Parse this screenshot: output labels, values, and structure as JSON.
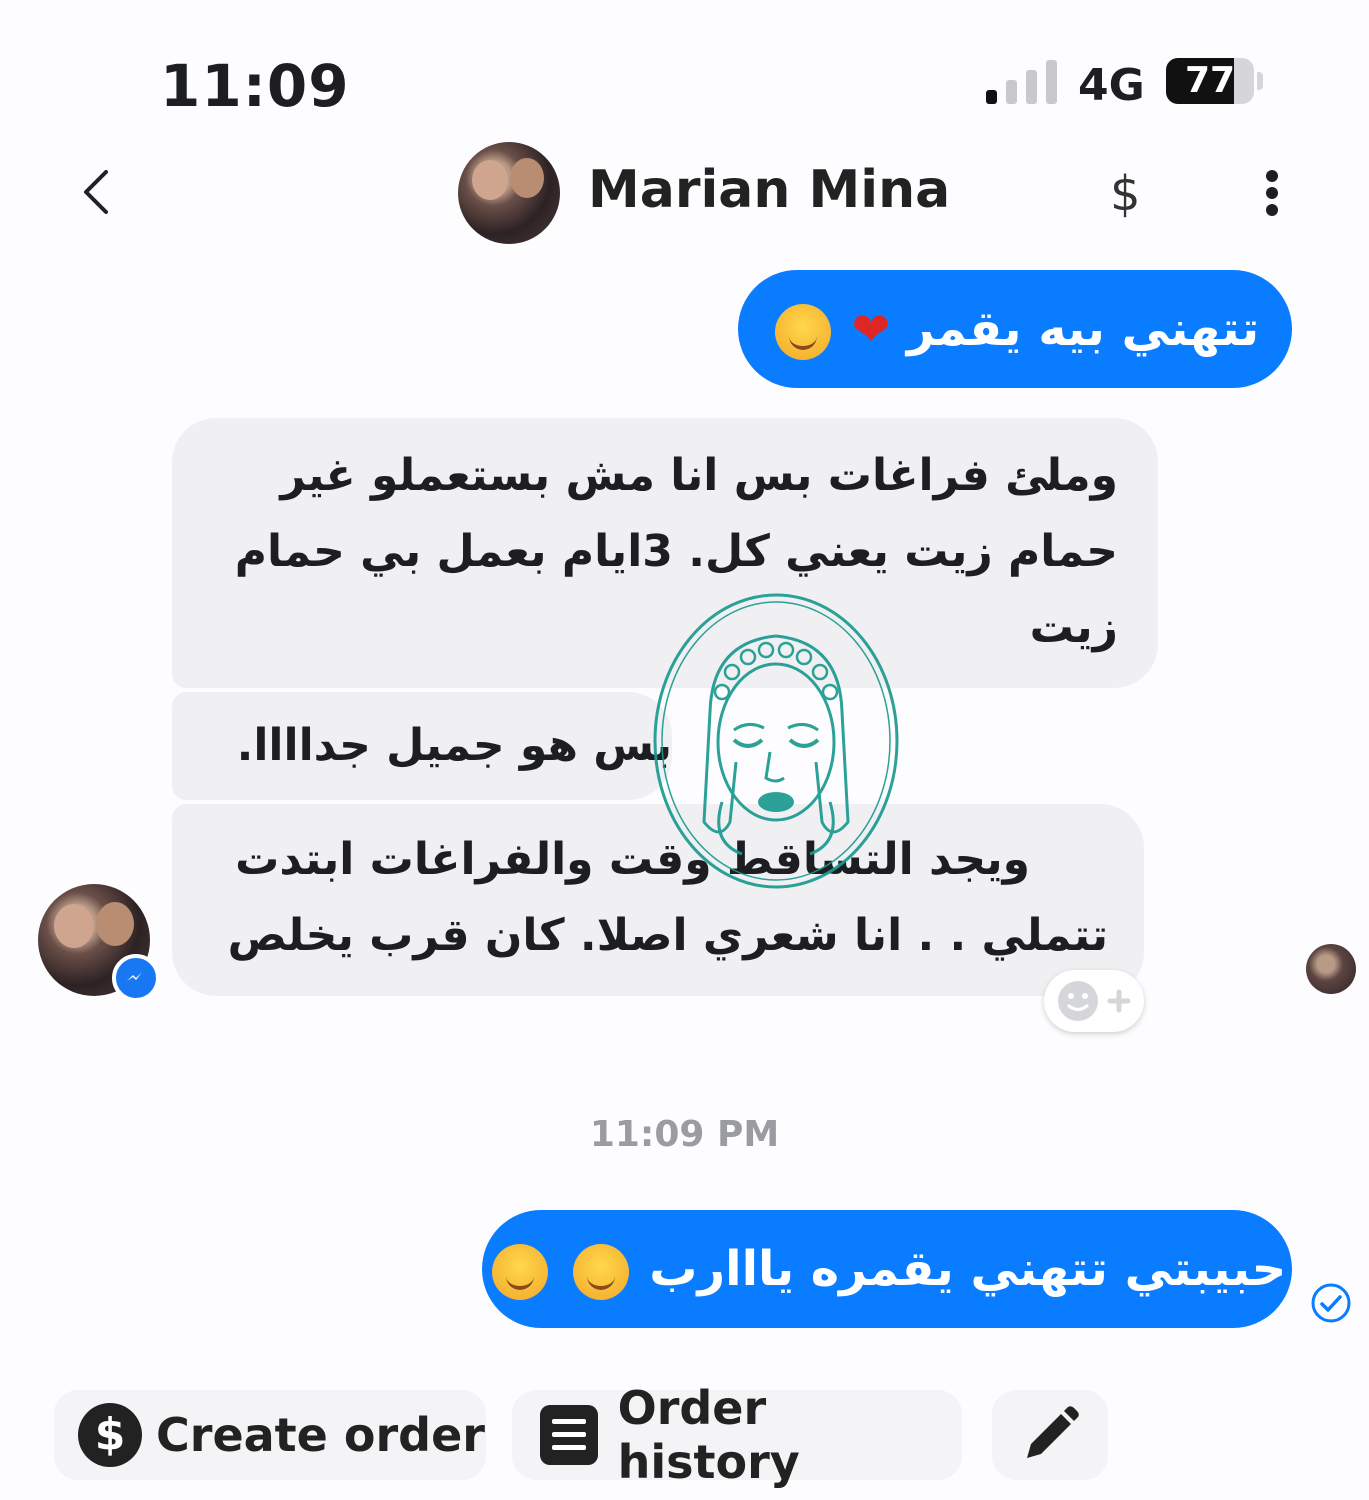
{
  "status_bar": {
    "time": "11:09",
    "network": "4G",
    "battery": "77",
    "battery_level": 0.77
  },
  "header": {
    "contact_name": "Marian Mina",
    "dollar_symbol": "$"
  },
  "messages": [
    {
      "direction": "out",
      "text": "تتهني بيه يقمر"
    },
    {
      "direction": "in",
      "lines": [
        "وملئ فراغات بس انا مش بستعملو غير",
        "حمام زيت يعني كل. 3ايام بعمل بي  حمام",
        "زيت"
      ]
    },
    {
      "direction": "in",
      "lines": [
        "بس هو جميل جداااا."
      ]
    },
    {
      "direction": "in",
      "lines": [
        "ويجد التساقط وقت والفراغات ابتدت",
        "تتملي . . انا شعري اصلا. كان قرب يخلص"
      ]
    },
    {
      "direction": "out",
      "text": "حبيبتي تتهني يقمره يااارب"
    }
  ],
  "timestamp": "11:09 PM",
  "actions": {
    "create_order": "Create order",
    "order_history": "Order history"
  },
  "colors": {
    "outgoing_bubble": "#0a7cff",
    "incoming_bubble": "#f0f0f2",
    "watermark": "#1a9a90"
  },
  "icons": [
    "back-chevron-icon",
    "dollar-icon",
    "more-vertical-icon",
    "messenger-icon",
    "add-reaction-icon",
    "sent-check-icon",
    "document-list-icon",
    "pencil-icon"
  ]
}
